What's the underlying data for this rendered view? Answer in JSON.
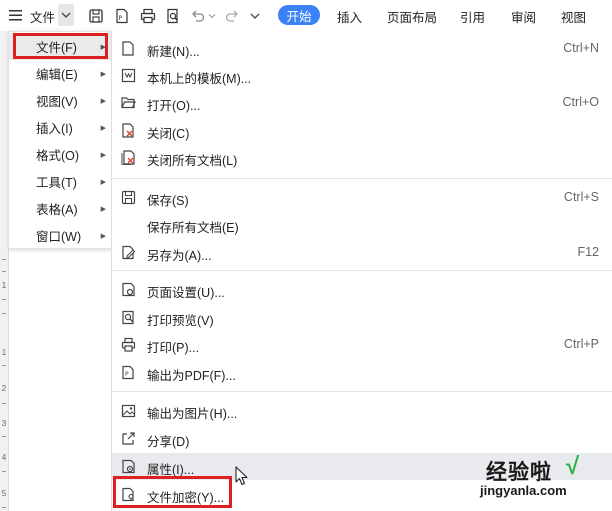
{
  "toolbar": {
    "menu_label": "文件",
    "tabs": [
      "开始",
      "插入",
      "页面布局",
      "引用",
      "审阅",
      "视图"
    ]
  },
  "ruler": {
    "numbers": [
      "1",
      "1",
      "2",
      "3",
      "4",
      "5"
    ]
  },
  "main_menu": {
    "items": [
      {
        "label": "文件(F)"
      },
      {
        "label": "编辑(E)"
      },
      {
        "label": "视图(V)"
      },
      {
        "label": "插入(I)"
      },
      {
        "label": "格式(O)"
      },
      {
        "label": "工具(T)"
      },
      {
        "label": "表格(A)"
      },
      {
        "label": "窗口(W)"
      }
    ]
  },
  "file_submenu": {
    "items": [
      {
        "label": "新建(N)...",
        "shortcut": "Ctrl+N",
        "icon": "new-file-icon"
      },
      {
        "label": "本机上的模板(M)...",
        "shortcut": "",
        "icon": "template-icon"
      },
      {
        "label": "打开(O)...",
        "shortcut": "Ctrl+O",
        "icon": "folder-open-icon"
      },
      {
        "label": "关闭(C)",
        "shortcut": "",
        "icon": "close-file-icon"
      },
      {
        "label": "关闭所有文档(L)",
        "shortcut": "",
        "icon": "close-all-icon"
      },
      {
        "label": "保存(S)",
        "shortcut": "Ctrl+S",
        "icon": "save-icon"
      },
      {
        "label": "保存所有文档(E)",
        "shortcut": "",
        "icon": ""
      },
      {
        "label": "另存为(A)...",
        "shortcut": "F12",
        "icon": "save-as-icon"
      },
      {
        "label": "页面设置(U)...",
        "shortcut": "",
        "icon": "page-setup-icon"
      },
      {
        "label": "打印预览(V)",
        "shortcut": "",
        "icon": "print-preview-icon"
      },
      {
        "label": "打印(P)...",
        "shortcut": "Ctrl+P",
        "icon": "printer-icon"
      },
      {
        "label": "输出为PDF(F)...",
        "shortcut": "",
        "icon": "export-pdf-icon"
      },
      {
        "label": "输出为图片(H)...",
        "shortcut": "",
        "icon": "export-image-icon"
      },
      {
        "label": "分享(D)",
        "shortcut": "",
        "icon": "share-icon"
      },
      {
        "label": "属性(I)...",
        "shortcut": "",
        "icon": "properties-icon"
      },
      {
        "label": "文件加密(Y)...",
        "shortcut": "",
        "icon": "encrypt-file-icon"
      }
    ]
  },
  "watermark": {
    "title": "经验啦",
    "check": "√",
    "url": "jingyanla.com"
  },
  "colors": {
    "active_tab_bg": "#3b82f6",
    "highlight_border": "#e02020",
    "hover_bg": "#e9eaed"
  }
}
